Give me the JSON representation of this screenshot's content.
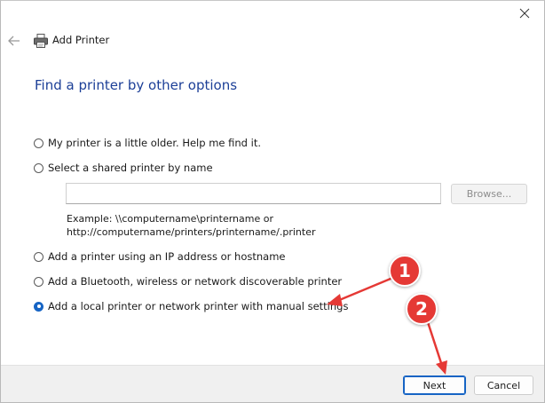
{
  "window": {
    "title": "Add Printer"
  },
  "page": {
    "heading": "Find a printer by other options"
  },
  "options": [
    {
      "label": "My printer is a little older. Help me find it.",
      "selected": false
    },
    {
      "label": "Select a shared printer by name",
      "selected": false
    },
    {
      "label": "Add a printer using an IP address or hostname",
      "selected": false
    },
    {
      "label": "Add a Bluetooth, wireless or network discoverable printer",
      "selected": false
    },
    {
      "label": "Add a local printer or network printer with manual settings",
      "selected": true
    }
  ],
  "shared_printer": {
    "value": "",
    "browse_label": "Browse...",
    "example_line1": "Example: \\\\computername\\printername or",
    "example_line2": "http://computername/printers/printername/.printer"
  },
  "footer": {
    "next_label": "Next",
    "cancel_label": "Cancel"
  },
  "annotations": {
    "callout_1": "1",
    "callout_2": "2",
    "color": "#e53935"
  },
  "colors": {
    "heading": "#1c3f97",
    "accent": "#1664c4",
    "footer_bg": "#f0f0f0"
  },
  "icons": {
    "close": "close-icon",
    "back": "back-arrow-icon",
    "printer": "printer-icon"
  }
}
